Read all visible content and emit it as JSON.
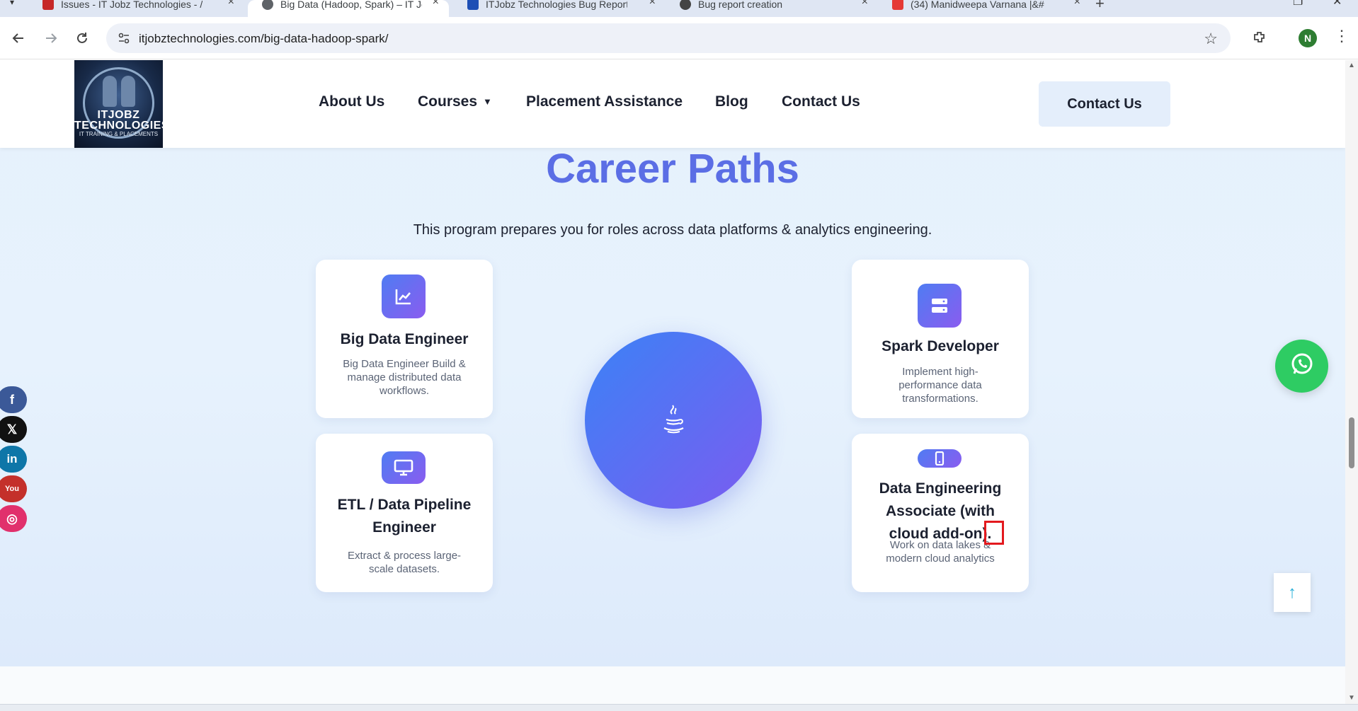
{
  "browser": {
    "tabs": [
      {
        "label": "Issues - IT Jobz Technologies - /",
        "active": false,
        "favicon_color": "#c62828"
      },
      {
        "label": "Big Data (Hadoop, Spark) – IT Jo",
        "active": true,
        "favicon_color": "#5f6368"
      },
      {
        "label": "ITJobz Technologies Bug Report",
        "active": false,
        "favicon_color": "#1e4fb5"
      },
      {
        "label": "Bug report creation",
        "active": false,
        "favicon_color": "#444444"
      },
      {
        "label": "(34) Manidweepa Varnana |&#",
        "active": false,
        "favicon_color": "#e53935"
      }
    ],
    "url": "itjobztechnologies.com/big-data-hadoop-spark/",
    "profile_initial": "N"
  },
  "header": {
    "logo": {
      "text": "ITJOBZ TECHNOLOGIES",
      "sub": "IT TRAINING & PLACEMENTS"
    },
    "nav": [
      {
        "label": "About Us"
      },
      {
        "label": "Courses",
        "has_dropdown": true
      },
      {
        "label": "Placement Assistance"
      },
      {
        "label": "Blog"
      },
      {
        "label": "Contact Us"
      }
    ],
    "cta_label": "Contact Us"
  },
  "section": {
    "title": "Career Paths",
    "subtitle": "This program prepares you for roles across data platforms & analytics engineering.",
    "center_icon": "java-icon",
    "cards": [
      {
        "title": "Big Data Engineer",
        "description": "Big Data Engineer Build & manage distributed data workflows.",
        "icon": "line-chart-icon"
      },
      {
        "title": "ETL / Data Pipeline Engineer",
        "description": "Extract & process large-scale datasets.",
        "icon": "desktop-icon"
      },
      {
        "title": "Spark Developer",
        "description": "Implement high-performance data transformations.",
        "icon": "server-icon"
      },
      {
        "title": "Data Engineering Associate (with cloud add-on).",
        "description": "Work on data lakes & modern cloud analytics",
        "icon": "mobile-icon"
      }
    ]
  },
  "social": [
    {
      "name": "facebook",
      "glyph": "f",
      "color": "#3b5998"
    },
    {
      "name": "x",
      "glyph": "𝕏",
      "color": "#111111"
    },
    {
      "name": "linkedin",
      "glyph": "in",
      "color": "#0e76a8"
    },
    {
      "name": "youtube",
      "glyph": "You",
      "color": "#c4302b"
    },
    {
      "name": "instagram",
      "glyph": "◎",
      "color": "#e1306c"
    }
  ],
  "colors": {
    "accent": "#5b6ee5",
    "gradient_start": "#4f7cf2",
    "gradient_end": "#8a5cf0",
    "whatsapp": "#2ecc63",
    "highlight": "#e3191e"
  }
}
